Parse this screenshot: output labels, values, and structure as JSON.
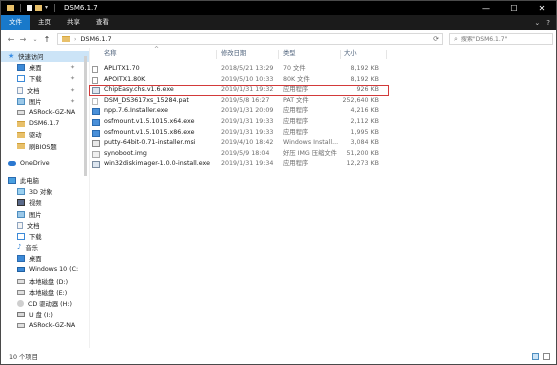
{
  "window": {
    "title": "DSM6.1.7",
    "controls": {
      "minimize": "—",
      "maximize": "☐",
      "close": "✕"
    }
  },
  "ribbon": {
    "tabs": [
      "文件",
      "主页",
      "共享",
      "查看"
    ],
    "help": "?"
  },
  "address": {
    "path": "DSM6.1.7",
    "search_placeholder": "搜索\"DSM6.1.7\""
  },
  "columns": {
    "name": "名称",
    "date": "修改日期",
    "type": "类型",
    "size": "大小"
  },
  "sidebar": {
    "quick_access": "快速访问",
    "pinned": [
      {
        "label": "桌面",
        "icon": "desktop-icon"
      },
      {
        "label": "下载",
        "icon": "download-icon"
      },
      {
        "label": "文档",
        "icon": "document-icon"
      },
      {
        "label": "图片",
        "icon": "picture-icon"
      }
    ],
    "recent": [
      {
        "label": "ASRock-GZ-NA",
        "icon": "drive-icon"
      },
      {
        "label": "DSM6.1.7",
        "icon": "folder-icon"
      },
      {
        "label": "驱动",
        "icon": "folder-icon"
      },
      {
        "label": "刷BIOS题",
        "icon": "folder-icon"
      }
    ],
    "onedrive": "OneDrive",
    "this_pc": "此电脑",
    "pc_items": [
      {
        "label": "3D 对象",
        "icon": "3d-objects-icon"
      },
      {
        "label": "视频",
        "icon": "video-icon"
      },
      {
        "label": "图片",
        "icon": "picture-icon"
      },
      {
        "label": "文档",
        "icon": "document-icon"
      },
      {
        "label": "下载",
        "icon": "download-icon"
      },
      {
        "label": "音乐",
        "icon": "music-icon"
      },
      {
        "label": "桌面",
        "icon": "desktop-icon"
      },
      {
        "label": "Windows 10 (C:",
        "icon": "windows-drive-icon"
      },
      {
        "label": "本地磁盘 (D:)",
        "icon": "drive-icon"
      },
      {
        "label": "本地磁盘 (E:)",
        "icon": "drive-icon"
      },
      {
        "label": "CD 驱动器 (H:)",
        "icon": "cd-drive-icon"
      },
      {
        "label": "U 盘 (I:)",
        "icon": "usb-drive-icon"
      },
      {
        "label": "ASRock-GZ-NA",
        "icon": "drive-icon"
      }
    ]
  },
  "files": [
    {
      "name": "APLITX1.70",
      "date": "2018/5/21 13:29",
      "type": "70 文件",
      "size": "8,192 KB",
      "icon": "file-icon"
    },
    {
      "name": "APOITX1.80K",
      "date": "2019/5/10 10:33",
      "type": "80K 文件",
      "size": "8,192 KB",
      "icon": "file-icon"
    },
    {
      "name": "ChipEasy.chs.v1.6.exe",
      "date": "2019/1/31 19:32",
      "type": "应用程序",
      "size": "926 KB",
      "icon": "exe-icon",
      "highlighted": true
    },
    {
      "name": "DSM_DS3617xs_15284.pat",
      "date": "2019/5/8 16:27",
      "type": "PAT 文件",
      "size": "252,640 KB",
      "icon": "pat-file-icon"
    },
    {
      "name": "npp.7.6.Installer.exe",
      "date": "2019/1/31 20:09",
      "type": "应用程序",
      "size": "4,216 KB",
      "icon": "exe-icon"
    },
    {
      "name": "osfmount.v1.5.1015.x64.exe",
      "date": "2019/1/31 19:33",
      "type": "应用程序",
      "size": "2,112 KB",
      "icon": "exe-icon"
    },
    {
      "name": "osfmount.v1.5.1015.x86.exe",
      "date": "2019/1/31 19:33",
      "type": "应用程序",
      "size": "1,995 KB",
      "icon": "exe-icon"
    },
    {
      "name": "putty-64bit-0.71-installer.msi",
      "date": "2019/4/10 18:42",
      "type": "Windows Install...",
      "size": "3,084 KB",
      "icon": "msi-icon"
    },
    {
      "name": "synoboot.img",
      "date": "2019/5/9 18:04",
      "type": "好压 IMG 压缩文件",
      "size": "51,200 KB",
      "icon": "img-file-icon"
    },
    {
      "name": "win32diskimager-1.0.0-install.exe",
      "date": "2019/1/31 19:34",
      "type": "应用程序",
      "size": "12,273 KB",
      "icon": "exe-icon"
    }
  ],
  "status": {
    "count": "10 个项目"
  }
}
